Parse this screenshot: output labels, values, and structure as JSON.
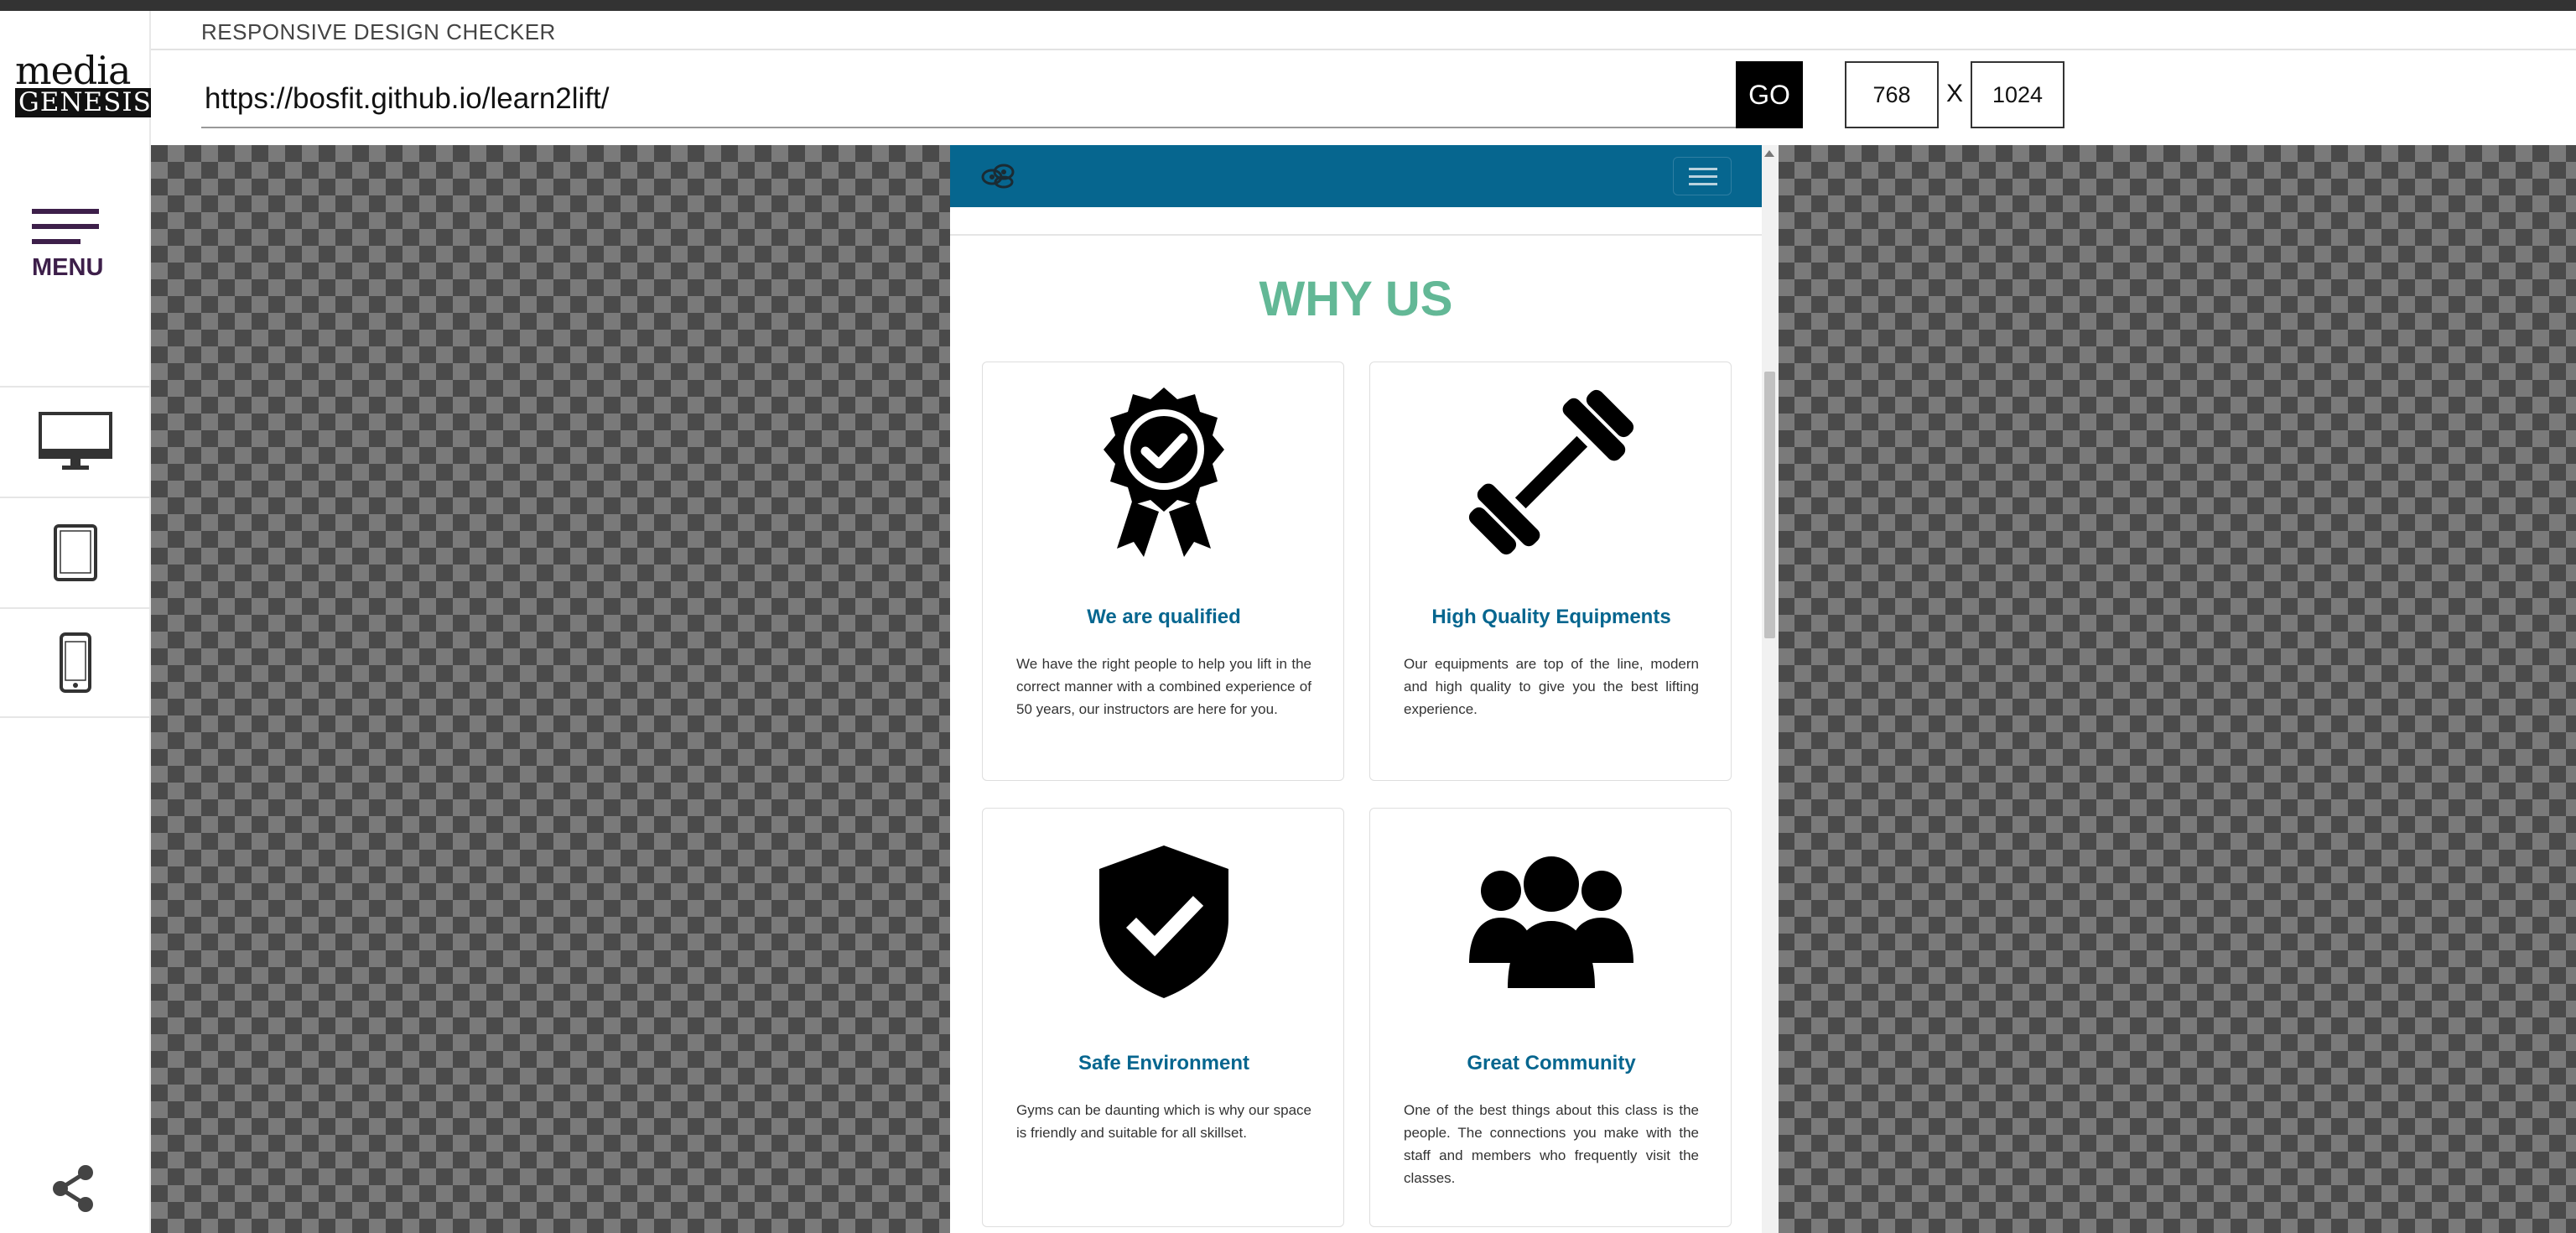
{
  "app": {
    "title": "RESPONSIVE DESIGN CHECKER",
    "logo_line1": "media",
    "logo_line2": "GENESIS"
  },
  "sidebar": {
    "menu_label": "MENU",
    "devices": [
      "desktop-icon",
      "tablet-icon",
      "phone-icon"
    ],
    "share_icon": "share-icon"
  },
  "toolbar": {
    "url_value": "https://bosfit.github.io/learn2lift/",
    "go_label": "GO",
    "width_value": "768",
    "separator": "X",
    "height_value": "1024"
  },
  "site": {
    "nav_color": "#06668f",
    "heading": "WHY US",
    "heading_color": "#63b896",
    "cards": [
      {
        "icon": "award-badge-icon",
        "title": "We are qualified",
        "text": "We have the right people to help you lift in the correct manner with a combined experience of 50 years, our instructors are here for you."
      },
      {
        "icon": "dumbbell-icon",
        "title": "High Quality Equipments",
        "text": "Our equipments are top of the line, modern and high quality to give you the best lifting experience."
      },
      {
        "icon": "shield-check-icon",
        "title": "Safe Environment",
        "text": "Gyms can be daunting which is why our space is friendly and suitable for all skillset."
      },
      {
        "icon": "users-group-icon",
        "title": "Great Community",
        "text": "One of the best things about this class is the people. The connections you make with the staff and members who frequently visit the classes."
      }
    ]
  }
}
